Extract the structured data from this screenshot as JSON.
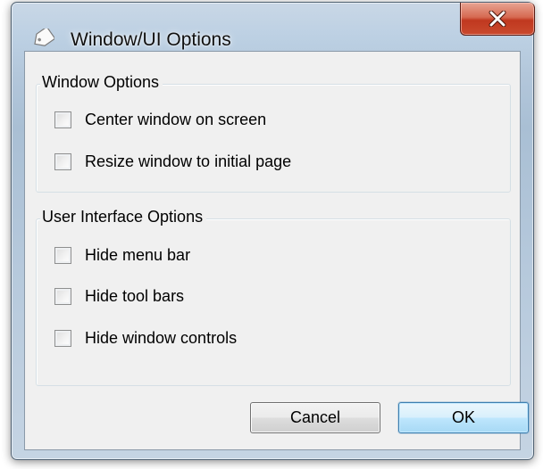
{
  "window": {
    "title": "Window/UI Options",
    "icon": "tag-icon",
    "close_icon": "close-icon"
  },
  "groups": [
    {
      "legend": "Window Options",
      "options": [
        {
          "label": "Center window on screen",
          "checked": false
        },
        {
          "label": "Resize window to initial page",
          "checked": false
        }
      ]
    },
    {
      "legend": "User Interface Options",
      "options": [
        {
          "label": "Hide menu bar",
          "checked": false
        },
        {
          "label": "Hide tool bars",
          "checked": false
        },
        {
          "label": "Hide window controls",
          "checked": false
        }
      ]
    }
  ],
  "buttons": {
    "cancel": "Cancel",
    "ok": "OK"
  },
  "colors": {
    "close_button": "#c94a2e",
    "ok_border": "#3c7fb1",
    "client_bg": "#f0f0f0"
  }
}
